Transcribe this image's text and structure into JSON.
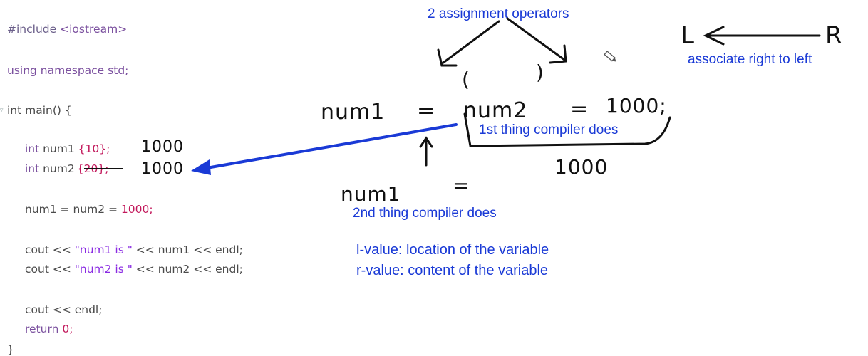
{
  "code": {
    "include_keyword": "#include",
    "include_header": "<iostream>",
    "using_line_a": "using namespace",
    "using_line_b": "std;",
    "main_signature": "int main() {",
    "decl1_type": "int",
    "decl1_name": "num1",
    "decl1_init": "{10};",
    "decl2_type": "int",
    "decl2_name": "num2",
    "decl2_init": "{20};",
    "assign_prefix": "num1 = num2 = ",
    "assign_value": "1000;",
    "cout1_prefix": "cout << ",
    "cout1_string": "\"num1 is \"",
    "cout1_suffix": " << num1 << endl;",
    "cout2_prefix": "cout << ",
    "cout2_string": "\"num2 is \"",
    "cout2_suffix": " << num2 << endl;",
    "endl_line": "cout << endl;",
    "return_kw": "return",
    "return_val": "0;",
    "closing_brace": "}"
  },
  "handwriting": {
    "num1_value": "1000",
    "num2_value": "1000",
    "expr_lhs": "num1",
    "expr_eq1": "=",
    "expr_mid": "num2",
    "expr_eq2": "=",
    "expr_val": "1000;",
    "paren_open": "(",
    "paren_close": ")",
    "result_1000": "1000",
    "second_lhs": "num1",
    "second_eq": "=",
    "dir_L": "L",
    "dir_R": "R"
  },
  "annotations": {
    "assignment_ops": "2 assignment operators",
    "associativity": "associate right to left",
    "first_thing": "1st thing compiler does",
    "second_thing": "2nd thing compiler does",
    "lvalue": "l-value: location of the variable",
    "rvalue": "r-value: content of the variable"
  },
  "colors": {
    "annotation_blue": "#1a3ad6",
    "ink": "#111111"
  }
}
